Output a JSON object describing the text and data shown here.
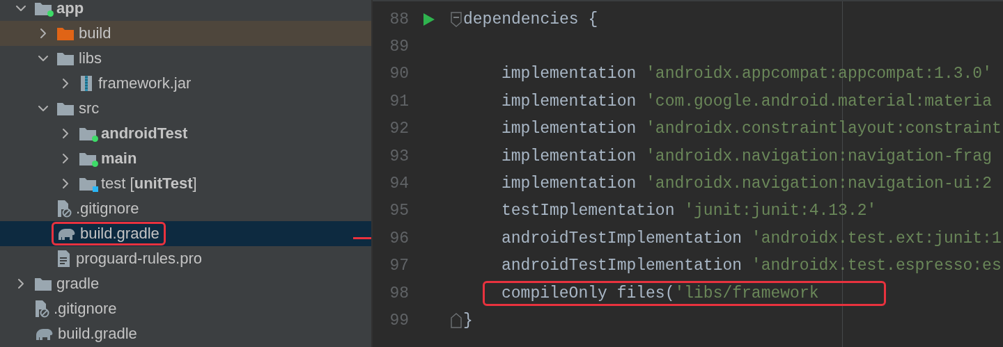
{
  "project_tree": {
    "items": [
      {
        "label": "app",
        "kind": "module",
        "expanded": true,
        "selected": false,
        "highlighted": false,
        "excluded": false,
        "bold": true,
        "vcs_dot": true,
        "test_badge": false,
        "children": [
          {
            "label": "build",
            "kind": "folder",
            "expanded": false,
            "selected": false,
            "highlighted": false,
            "excluded": true,
            "bold": false,
            "vcs_dot": false,
            "test_badge": false
          },
          {
            "label": "libs",
            "kind": "folder",
            "expanded": true,
            "selected": false,
            "highlighted": false,
            "excluded": false,
            "bold": false,
            "vcs_dot": false,
            "test_badge": false,
            "children": [
              {
                "label": "framework.jar",
                "kind": "jar",
                "expanded": false,
                "selected": false,
                "highlighted": false,
                "excluded": false,
                "bold": false,
                "vcs_dot": false,
                "test_badge": false
              }
            ]
          },
          {
            "label": "src",
            "kind": "folder",
            "expanded": true,
            "selected": false,
            "highlighted": false,
            "excluded": false,
            "bold": false,
            "vcs_dot": false,
            "test_badge": false,
            "children": [
              {
                "label": "androidTest",
                "kind": "folder",
                "expanded": false,
                "selected": false,
                "highlighted": false,
                "excluded": false,
                "bold": true,
                "vcs_dot": true,
                "test_badge": false
              },
              {
                "label": "main",
                "kind": "folder",
                "expanded": false,
                "selected": false,
                "highlighted": false,
                "excluded": false,
                "bold": true,
                "vcs_dot": true,
                "test_badge": false
              },
              {
                "label": "test [**unitTest**]",
                "kind": "folder",
                "expanded": false,
                "selected": false,
                "highlighted": false,
                "excluded": false,
                "bold": false,
                "vcs_dot": false,
                "test_badge": true
              }
            ]
          },
          {
            "label": ".gitignore",
            "kind": "ignore-file",
            "selected": false,
            "highlighted": false,
            "excluded": false,
            "bold": false,
            "vcs_dot": false,
            "test_badge": false
          },
          {
            "label": "build.gradle",
            "kind": "gradle",
            "selected": true,
            "highlighted": true,
            "excluded": false,
            "bold": false,
            "vcs_dot": false,
            "test_badge": false
          },
          {
            "label": "proguard-rules.pro",
            "kind": "text-file",
            "selected": false,
            "highlighted": false,
            "excluded": false,
            "bold": false,
            "vcs_dot": false,
            "test_badge": false
          }
        ]
      },
      {
        "label": "gradle",
        "kind": "folder",
        "expanded": false,
        "selected": false,
        "highlighted": false,
        "excluded": false,
        "bold": false,
        "vcs_dot": false,
        "test_badge": false
      },
      {
        "label": ".gitignore",
        "kind": "ignore-file",
        "selected": false,
        "highlighted": false,
        "excluded": false,
        "bold": false,
        "vcs_dot": false,
        "test_badge": false
      },
      {
        "label": "build.gradle",
        "kind": "gradle",
        "selected": false,
        "highlighted": false,
        "excluded": false,
        "bold": false,
        "vcs_dot": false,
        "test_badge": false
      }
    ]
  },
  "editor": {
    "lines": [
      {
        "number": "88",
        "run": true,
        "fold_start": true,
        "fold_end": false,
        "indented": false,
        "highlighted": false,
        "tokens": [
          {
            "kind": "plain",
            "text": "dependencies {"
          }
        ]
      },
      {
        "number": "89",
        "run": false,
        "fold_start": false,
        "fold_end": false
      },
      {
        "number": "90",
        "run": false,
        "fold_start": false,
        "fold_end": false,
        "indented": true,
        "highlighted": false,
        "tokens": [
          {
            "kind": "plain",
            "text": "implementation "
          },
          {
            "kind": "string",
            "text": "'androidx.appcompat:appcompat:1.3.0'"
          }
        ]
      },
      {
        "number": "91",
        "run": false,
        "fold_start": false,
        "fold_end": false,
        "indented": true,
        "highlighted": false,
        "tokens": [
          {
            "kind": "plain",
            "text": "implementation "
          },
          {
            "kind": "string",
            "text": "'com.google.android.material:materia"
          }
        ]
      },
      {
        "number": "92",
        "run": false,
        "fold_start": false,
        "fold_end": false,
        "indented": true,
        "highlighted": false,
        "tokens": [
          {
            "kind": "plain",
            "text": "implementation "
          },
          {
            "kind": "string",
            "text": "'androidx.constraintlayout:constraint"
          }
        ]
      },
      {
        "number": "93",
        "run": false,
        "fold_start": false,
        "fold_end": false,
        "indented": true,
        "highlighted": false,
        "tokens": [
          {
            "kind": "plain",
            "text": "implementation "
          },
          {
            "kind": "string",
            "text": "'androidx.navigation:navigation-frag"
          }
        ]
      },
      {
        "number": "94",
        "run": false,
        "fold_start": false,
        "fold_end": false,
        "indented": true,
        "highlighted": false,
        "tokens": [
          {
            "kind": "plain",
            "text": "implementation "
          },
          {
            "kind": "string",
            "text": "'androidx.navigation:navigation-ui:2"
          }
        ]
      },
      {
        "number": "95",
        "run": false,
        "fold_start": false,
        "fold_end": false,
        "indented": true,
        "highlighted": false,
        "tokens": [
          {
            "kind": "plain",
            "text": "testImplementation "
          },
          {
            "kind": "string",
            "text": "'junit:junit:4.13.2'"
          }
        ]
      },
      {
        "number": "96",
        "run": false,
        "fold_start": false,
        "fold_end": false,
        "indented": true,
        "highlighted": false,
        "tokens": [
          {
            "kind": "plain",
            "text": "androidTestImplementation "
          },
          {
            "kind": "string",
            "text": "'androidx.test.ext:junit:1"
          }
        ]
      },
      {
        "number": "97",
        "run": false,
        "fold_start": false,
        "fold_end": false,
        "indented": true,
        "highlighted": false,
        "tokens": [
          {
            "kind": "plain",
            "text": "androidTestImplementation "
          },
          {
            "kind": "string",
            "text": "'androidx.test.espresso:es"
          }
        ]
      },
      {
        "number": "98",
        "run": false,
        "fold_start": false,
        "fold_end": false,
        "indented": true,
        "highlighted": true,
        "tokens": [
          {
            "kind": "plain",
            "text": "compileOnly files("
          },
          {
            "kind": "string",
            "text": "'libs/framework"
          }
        ]
      },
      {
        "number": "99",
        "run": false,
        "fold_start": false,
        "fold_end": true,
        "indented": false,
        "highlighted": false,
        "tokens": [
          {
            "kind": "plain",
            "text": "}"
          }
        ]
      }
    ]
  }
}
